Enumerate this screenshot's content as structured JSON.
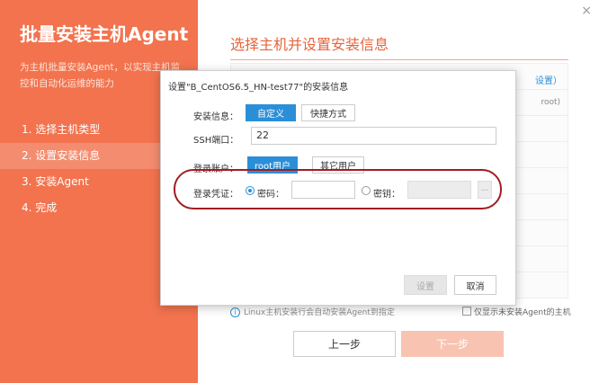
{
  "sidebar": {
    "title": "批量安装主机Agent",
    "desc": "为主机批量安装Agent，以实现主机监控和自动化运维的能力",
    "steps": [
      "1. 选择主机类型",
      "2. 设置安装信息",
      "3. 安装Agent",
      "4. 完成"
    ],
    "active_step": 1
  },
  "main": {
    "title": "选择主机并设置安装信息",
    "close_icon": "×",
    "table_settings_link": "设置）",
    "table_root_text": "root)",
    "tip_icon": "i",
    "tip": "Linux主机安装行会自动安装Agent到指定",
    "only_new_label": "仅显示未安装Agent的主机",
    "prev_label": "上一步",
    "next_label": "下一步"
  },
  "dialog": {
    "title": "设置\"B_CentOS6.5_HN-test77\"的安装信息",
    "install_info_label": "安装信息：",
    "custom_label": "自定义",
    "quick_label": "快捷方式",
    "ssh_port_label": "SSH端口：",
    "ssh_port_value": "22",
    "account_label": "登录账户：",
    "root_user_label": "root用户",
    "other_user_label": "其它用户",
    "credential_label": "登录凭证：",
    "password_label": "密码：",
    "password_value": "",
    "key_label": "密钥：",
    "key_value": "",
    "browse_label": "...",
    "set_label": "设置",
    "cancel_label": "取消"
  },
  "colors": {
    "sidebar_bg": "#f2734e",
    "accent_blue": "#2b8fd8",
    "highlight_ring": "#a11c22"
  }
}
